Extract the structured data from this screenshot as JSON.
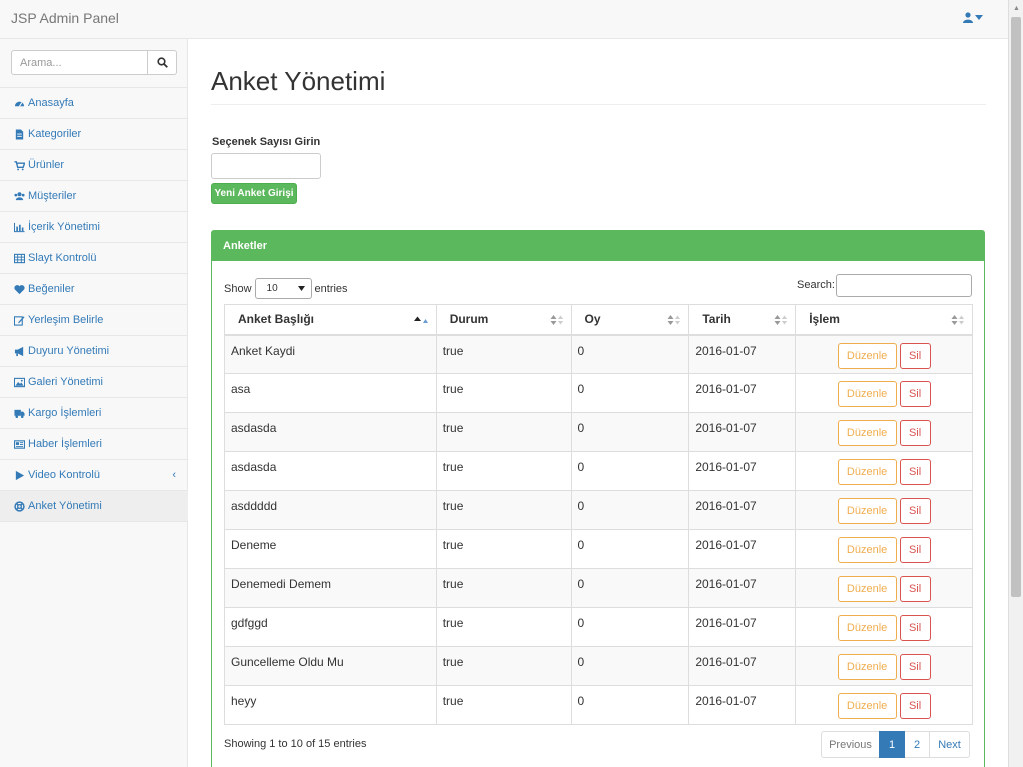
{
  "app": {
    "brand": "JSP Admin Panel"
  },
  "sidebar": {
    "search_placeholder": "Arama...",
    "items": [
      {
        "label": "Anasayfa",
        "icon": "dashboard-icon"
      },
      {
        "label": "Kategoriler",
        "icon": "file-icon"
      },
      {
        "label": "Ürünler",
        "icon": "cart-icon"
      },
      {
        "label": "Müşteriler",
        "icon": "users-icon"
      },
      {
        "label": "İçerik Yönetimi",
        "icon": "bar-chart-icon"
      },
      {
        "label": "Slayt Kontrolü",
        "icon": "table-icon"
      },
      {
        "label": "Beğeniler",
        "icon": "heart-icon"
      },
      {
        "label": "Yerleşim Belirle",
        "icon": "edit-icon"
      },
      {
        "label": "Duyuru Yönetimi",
        "icon": "bullhorn-icon"
      },
      {
        "label": "Galeri Yönetimi",
        "icon": "image-icon"
      },
      {
        "label": "Kargo İşlemleri",
        "icon": "truck-icon"
      },
      {
        "label": "Haber İşlemleri",
        "icon": "newspaper-icon"
      },
      {
        "label": "Video Kontrolü",
        "icon": "play-icon",
        "arrow": "‹"
      },
      {
        "label": "Anket Yönetimi",
        "icon": "life-ring-icon",
        "active": true
      }
    ]
  },
  "main": {
    "title": "Anket Yönetimi",
    "option_label": "Seçenek Sayısı Girin",
    "option_value": "",
    "new_button": "Yeni Anket Girişi"
  },
  "panel": {
    "heading": "Anketler",
    "show_prefix": "Show",
    "page_length": "10",
    "show_suffix": "entries",
    "search_label": "Search:",
    "columns": [
      "Anket Başlığı",
      "Durum",
      "Oy",
      "Tarih",
      "İşlem"
    ],
    "rows": [
      [
        "Anket Kaydi",
        "true",
        "0",
        "2016-01-07"
      ],
      [
        "asa",
        "true",
        "0",
        "2016-01-07"
      ],
      [
        "asdasda",
        "true",
        "0",
        "2016-01-07"
      ],
      [
        "asdasda",
        "true",
        "0",
        "2016-01-07"
      ],
      [
        "asddddd",
        "true",
        "0",
        "2016-01-07"
      ],
      [
        "Deneme",
        "true",
        "0",
        "2016-01-07"
      ],
      [
        "Denemedi Demem",
        "true",
        "0",
        "2016-01-07"
      ],
      [
        "gdfggd",
        "true",
        "0",
        "2016-01-07"
      ],
      [
        "Guncelleme Oldu Mu",
        "true",
        "0",
        "2016-01-07"
      ],
      [
        "heyy",
        "true",
        "0",
        "2016-01-07"
      ]
    ],
    "edit_label": "Düzenle",
    "delete_label": "Sil",
    "info": "Showing 1 to 10 of 15 entries",
    "pagination": {
      "previous": "Previous",
      "pages": [
        "1",
        "2"
      ],
      "current": "1",
      "next": "Next"
    }
  },
  "colors": {
    "primary": "#337ab7",
    "success": "#5cb85c",
    "warning": "#f0ad4e",
    "danger": "#d9534f"
  }
}
